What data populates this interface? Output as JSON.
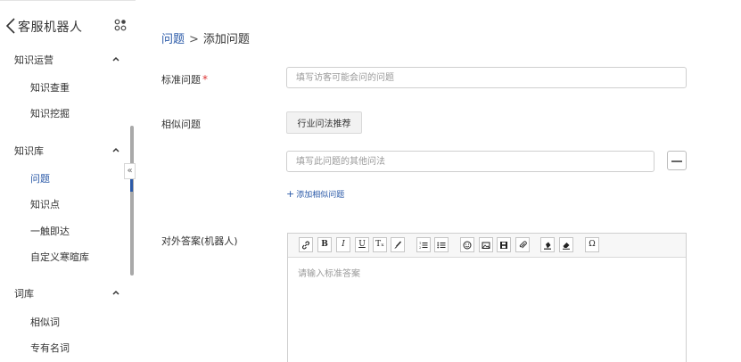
{
  "sidebar": {
    "title": "客服机器人",
    "groups": [
      {
        "title": "知识运营",
        "items": [
          "知识查重",
          "知识挖掘"
        ]
      },
      {
        "title": "知识库",
        "items": [
          "问题",
          "知识点",
          "一触即达",
          "自定义寒暄库"
        ]
      },
      {
        "title": "词库",
        "items": [
          "相似词",
          "专有名词"
        ]
      }
    ],
    "active_item": "问题",
    "collapse_glyph": "«"
  },
  "breadcrumb": {
    "parent": "问题",
    "separator": ">",
    "current": "添加问题"
  },
  "form": {
    "standard_question": {
      "label": "标准问题",
      "required_mark": "*",
      "placeholder": "填写访客可能会问的问题"
    },
    "similar_question": {
      "label": "相似问题",
      "recommend_button": "行业问法推荐",
      "placeholder": "填写此问题的其他问法",
      "add_link_plus": "+",
      "add_link": "添加相似问题"
    },
    "answer": {
      "label": "对外答案(机器人)",
      "placeholder": "请输入标准答案"
    }
  },
  "toolbar": {
    "buttons": [
      "link-icon",
      "bold",
      "italic",
      "underline",
      "text-format",
      "brush",
      "ordered-list",
      "unordered-list",
      "emoji",
      "image",
      "video",
      "attachment",
      "paint-bucket",
      "eraser",
      "omega"
    ],
    "bold": "B",
    "italic": "I",
    "underline": "U",
    "text_format": "Tₓ",
    "omega": "Ω"
  },
  "colors": {
    "accent": "#2b5aa8",
    "required": "#dd3333",
    "border": "#cfcfcf",
    "placeholder": "#9a9a9a"
  }
}
